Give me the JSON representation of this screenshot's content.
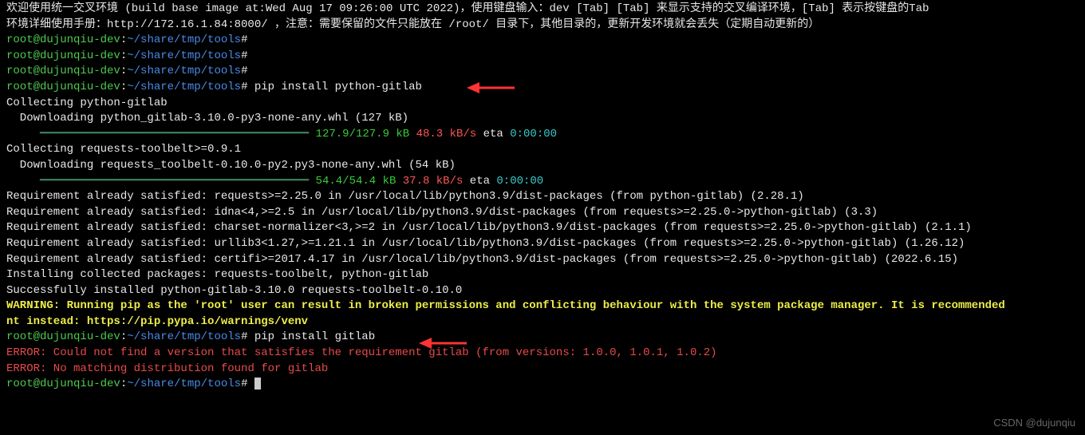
{
  "header": {
    "line1": "欢迎使用统一交叉环境 (build base image at:Wed Aug 17 09:26:00 UTC 2022)，使用键盘输入：dev [Tab] [Tab] 来显示支持的交叉编译环境，[Tab] 表示按键盘的Tab",
    "line2": "环境详细使用手册：http://172.16.1.84:8000/ ，注意：需要保留的文件只能放在 /root/ 目录下，其他目录的，更新开发环境就会丢失（定期自动更新的）"
  },
  "prompt": {
    "user_host": "root@dujunqiu-dev",
    "colon": ":",
    "path": "~/share/tmp/tools",
    "hash": "#"
  },
  "commands": {
    "cmd1": " pip install python-gitlab",
    "cmd2": " pip install gitlab"
  },
  "output": {
    "collecting1": "Collecting python-gitlab",
    "downloading1": "  Downloading python_gitlab-3.10.0-py3-none-any.whl (127 kB)",
    "progress1": {
      "bar": "     ━━━━━━━━━━━━━━━━━━━━━━━━━━━━━━━━━━━━━━━━",
      "size": " 127.9/127.9 kB",
      "speed": " 48.3 kB/s",
      "eta_label": " eta",
      "eta": " 0:00:00"
    },
    "collecting2": "Collecting requests-toolbelt>=0.9.1",
    "downloading2": "  Downloading requests_toolbelt-0.10.0-py2.py3-none-any.whl (54 kB)",
    "progress2": {
      "bar": "     ━━━━━━━━━━━━━━━━━━━━━━━━━━━━━━━━━━━━━━━━",
      "size": " 54.4/54.4 kB",
      "speed": " 37.8 kB/s",
      "eta_label": " eta",
      "eta": " 0:00:00"
    },
    "req1": "Requirement already satisfied: requests>=2.25.0 in /usr/local/lib/python3.9/dist-packages (from python-gitlab) (2.28.1)",
    "req2": "Requirement already satisfied: idna<4,>=2.5 in /usr/local/lib/python3.9/dist-packages (from requests>=2.25.0->python-gitlab) (3.3)",
    "req3": "Requirement already satisfied: charset-normalizer<3,>=2 in /usr/local/lib/python3.9/dist-packages (from requests>=2.25.0->python-gitlab) (2.1.1)",
    "req4": "Requirement already satisfied: urllib3<1.27,>=1.21.1 in /usr/local/lib/python3.9/dist-packages (from requests>=2.25.0->python-gitlab) (1.26.12)",
    "req5": "Requirement already satisfied: certifi>=2017.4.17 in /usr/local/lib/python3.9/dist-packages (from requests>=2.25.0->python-gitlab) (2022.6.15)",
    "installing": "Installing collected packages: requests-toolbelt, python-gitlab",
    "success": "Successfully installed python-gitlab-3.10.0 requests-toolbelt-0.10.0",
    "warning1": "WARNING: Running pip as the 'root' user can result in broken permissions and conflicting behaviour with the system package manager. It is recommended ",
    "warning2": "nt instead: https://pip.pypa.io/warnings/venv",
    "error1": "ERROR: Could not find a version that satisfies the requirement gitlab (from versions: 1.0.0, 1.0.1, 1.0.2)",
    "error2": "ERROR: No matching distribution found for gitlab"
  },
  "watermark": "CSDN @dujunqiu"
}
